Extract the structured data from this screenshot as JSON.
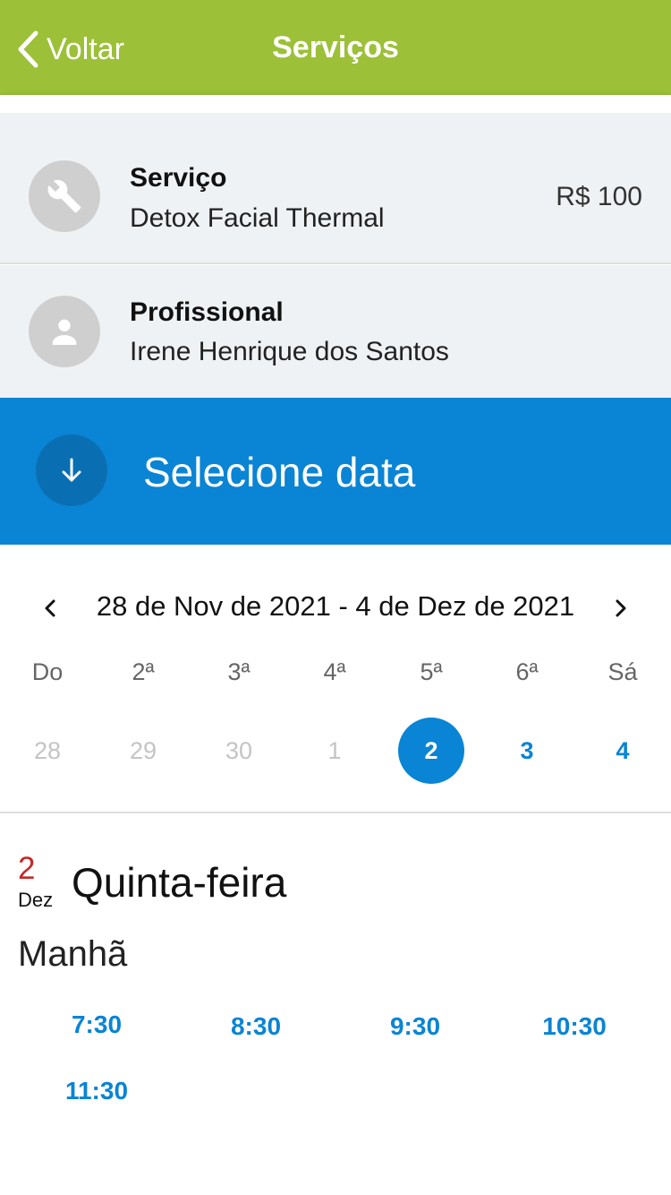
{
  "header": {
    "back_label": "Voltar",
    "title": "Serviços"
  },
  "service": {
    "label": "Serviço",
    "name": "Detox Facial Thermal",
    "price": "R$ 100",
    "icon": "wrench-icon"
  },
  "professional": {
    "label": "Profissional",
    "name": "Irene Henrique dos Santos",
    "icon": "person-icon"
  },
  "date_banner": {
    "title": "Selecione data",
    "icon": "arrow-down-icon"
  },
  "calendar": {
    "range_label": "28 de Nov de 2021 - 4 de Dez de 2021",
    "weekdays": [
      "Do",
      "2ª",
      "3ª",
      "4ª",
      "5ª",
      "6ª",
      "Sá"
    ],
    "days": [
      {
        "label": "28",
        "state": "disabled"
      },
      {
        "label": "29",
        "state": "disabled"
      },
      {
        "label": "30",
        "state": "disabled"
      },
      {
        "label": "1",
        "state": "disabled"
      },
      {
        "label": "2",
        "state": "selected"
      },
      {
        "label": "3",
        "state": "available"
      },
      {
        "label": "4",
        "state": "available"
      }
    ]
  },
  "selected_date": {
    "day": "2",
    "month": "Dez",
    "weekday": "Quinta-feira"
  },
  "schedule": {
    "period": "Manhã",
    "slots": [
      "7:30",
      "8:30",
      "9:30",
      "10:30",
      "11:30"
    ]
  },
  "colors": {
    "header_green": "#9cc038",
    "accent_blue": "#0a84d4",
    "day_red": "#c62828"
  }
}
